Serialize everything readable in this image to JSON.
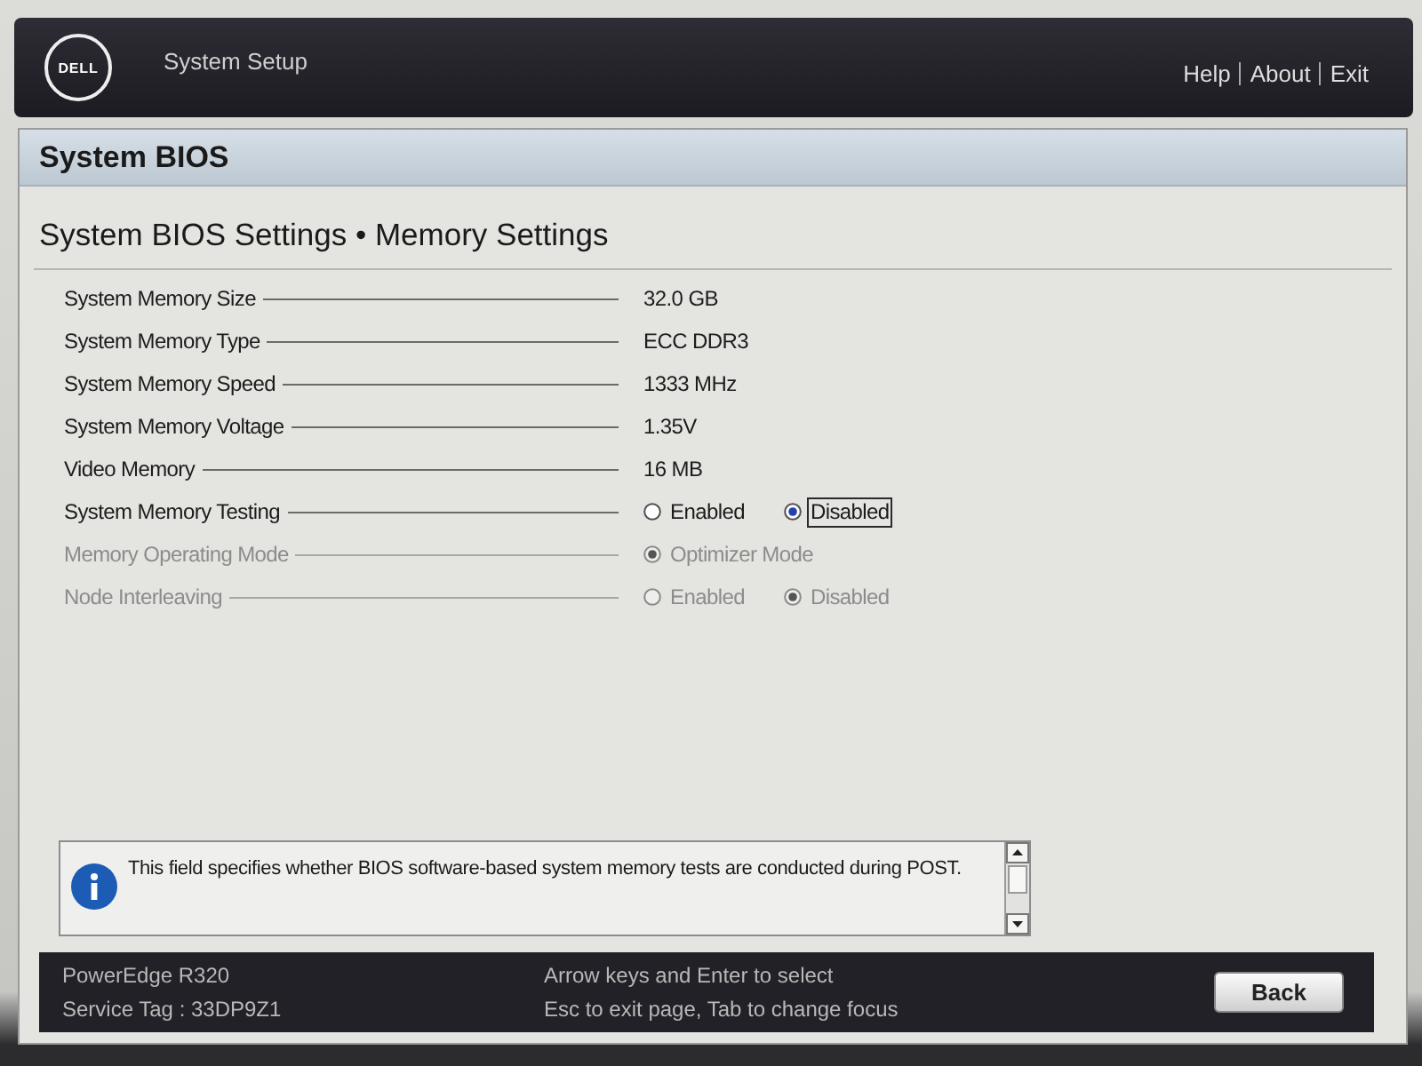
{
  "header": {
    "logo": "DELL",
    "title": "System Setup",
    "links": [
      "Help",
      "About",
      "Exit"
    ]
  },
  "page": {
    "title": "System BIOS",
    "breadcrumb": "System BIOS Settings • Memory Settings"
  },
  "settings": [
    {
      "kind": "value",
      "label": "System Memory Size",
      "value": "32.0 GB",
      "disabled": false
    },
    {
      "kind": "value",
      "label": "System Memory Type",
      "value": "ECC DDR3",
      "disabled": false
    },
    {
      "kind": "value",
      "label": "System Memory Speed",
      "value": "1333 MHz",
      "disabled": false
    },
    {
      "kind": "value",
      "label": "System Memory Voltage",
      "value": "1.35V",
      "disabled": false
    },
    {
      "kind": "value",
      "label": "Video Memory",
      "value": "16 MB",
      "disabled": false
    },
    {
      "kind": "radio",
      "label": "System Memory Testing",
      "disabled": false,
      "options": [
        {
          "label": "Enabled",
          "selected": false,
          "focused": false
        },
        {
          "label": "Disabled",
          "selected": true,
          "focused": true
        }
      ]
    },
    {
      "kind": "radio",
      "label": "Memory Operating Mode",
      "disabled": true,
      "options": [
        {
          "label": "Optimizer Mode",
          "selected": true,
          "focused": false
        }
      ]
    },
    {
      "kind": "radio",
      "label": "Node Interleaving",
      "disabled": true,
      "options": [
        {
          "label": "Enabled",
          "selected": false,
          "focused": false
        },
        {
          "label": "Disabled",
          "selected": true,
          "focused": false
        }
      ]
    }
  ],
  "help": {
    "text": "This field specifies whether BIOS software-based system memory tests are conducted during POST."
  },
  "footer": {
    "model": "PowerEdge R320",
    "service_tag": "Service Tag : 33DP9Z1",
    "hints": [
      "Arrow keys and Enter to select",
      "Esc to exit page, Tab to change focus"
    ],
    "button": "Back"
  }
}
